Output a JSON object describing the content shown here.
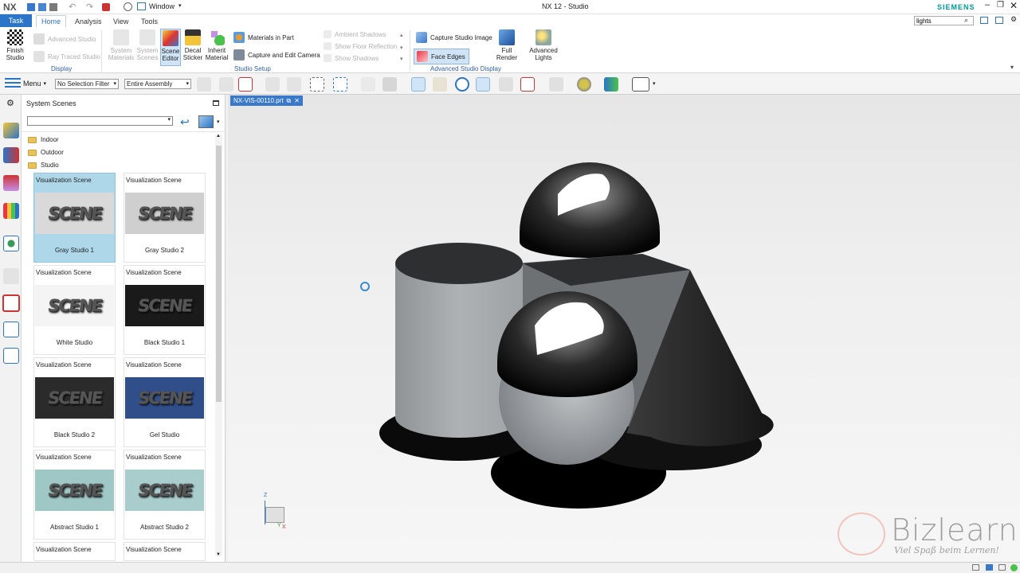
{
  "window": {
    "app_logo": "NX",
    "title": "NX 12 - Studio",
    "brand": "SIEMENS",
    "window_menu_label": "Window",
    "search_value": "lights",
    "controls": [
      "minimize-icon",
      "restore-icon",
      "close-icon"
    ]
  },
  "menubar": {
    "tabs": [
      "Task",
      "Home",
      "Analysis",
      "View",
      "Tools"
    ],
    "active_tab": "Home"
  },
  "ribbon": {
    "display": {
      "finish_studio": "Finish Studio",
      "advanced_studio": "Advanced Studio",
      "ray_traced_studio": "Ray Traced Studio",
      "group_label": "Display"
    },
    "studio_setup": {
      "system_materials": "System Materials",
      "system_scenes": "System Scenes",
      "scene_editor": "Scene Editor",
      "decal_sticker": "Decal Sticker",
      "inherit_material": "Inherit Material",
      "materials_in_part": "Materials in Part",
      "capture_edit_camera": "Capture and Edit Camera",
      "ambient_shadows": "Ambient Shadows",
      "show_floor_reflection": "Show Floor Reflection",
      "show_shadows": "Show Shadows",
      "group_label": "Studio Setup"
    },
    "advanced_display": {
      "capture_studio_image": "Capture Studio Image",
      "face_edges": "Face Edges",
      "full_render": "Full Render",
      "advanced_lights": "Advanced Lights",
      "group_label": "Advanced Studio Display"
    }
  },
  "toolbar": {
    "menu_label": "Menu",
    "selection_filter": "No Selection Filter",
    "assembly_scope": "Entire Assembly"
  },
  "panel": {
    "title": "System Scenes",
    "folders": [
      "Indoor",
      "Outdoor",
      "Studio"
    ],
    "scenes": [
      {
        "type": "Visualization Scene",
        "name": "Gray Studio 1",
        "thumb_text": "SCENE",
        "bg": "#d9d9d9",
        "selected": true
      },
      {
        "type": "Visualization Scene",
        "name": "Gray Studio 2",
        "thumb_text": "SCENE",
        "bg": "#cfcfcf",
        "selected": false
      },
      {
        "type": "Visualization Scene",
        "name": "White Studio",
        "thumb_text": "SCENE",
        "bg": "#f4f4f4",
        "selected": false
      },
      {
        "type": "Visualization Scene",
        "name": "Black Studio 1",
        "thumb_text": "SCENE",
        "bg": "#1a1a1a",
        "selected": false
      },
      {
        "type": "Visualization Scene",
        "name": "Black Studio 2",
        "thumb_text": "SCENE",
        "bg": "#2b2b2b",
        "selected": false
      },
      {
        "type": "Visualization Scene",
        "name": "Gel Studio",
        "thumb_text": "SCENE",
        "bg": "#2f4e8a",
        "selected": false
      },
      {
        "type": "Visualization Scene",
        "name": "Abstract Studio 1",
        "thumb_text": "SCENE",
        "bg": "#9fc7c5",
        "selected": false
      },
      {
        "type": "Visualization Scene",
        "name": "Abstract Studio 2",
        "thumb_text": "SCENE",
        "bg": "#a8cdcc",
        "selected": false
      },
      {
        "type": "Visualization Scene",
        "name": "",
        "thumb_text": "",
        "bg": "#ffffff",
        "selected": false
      },
      {
        "type": "Visualization Scene",
        "name": "",
        "thumb_text": "",
        "bg": "#ffffff",
        "selected": false
      }
    ]
  },
  "viewport": {
    "tab_label": "NX-VIS-00110.prt",
    "triad": {
      "z": "Z",
      "y": "Y",
      "x": "X"
    },
    "watermark": {
      "name": "Bizlearn",
      "tagline": "Viel Spaß beim Lernen!"
    }
  },
  "colors": {
    "accent": "#2b74c7",
    "selected_card": "#aed8ea",
    "siemens": "#009999"
  }
}
